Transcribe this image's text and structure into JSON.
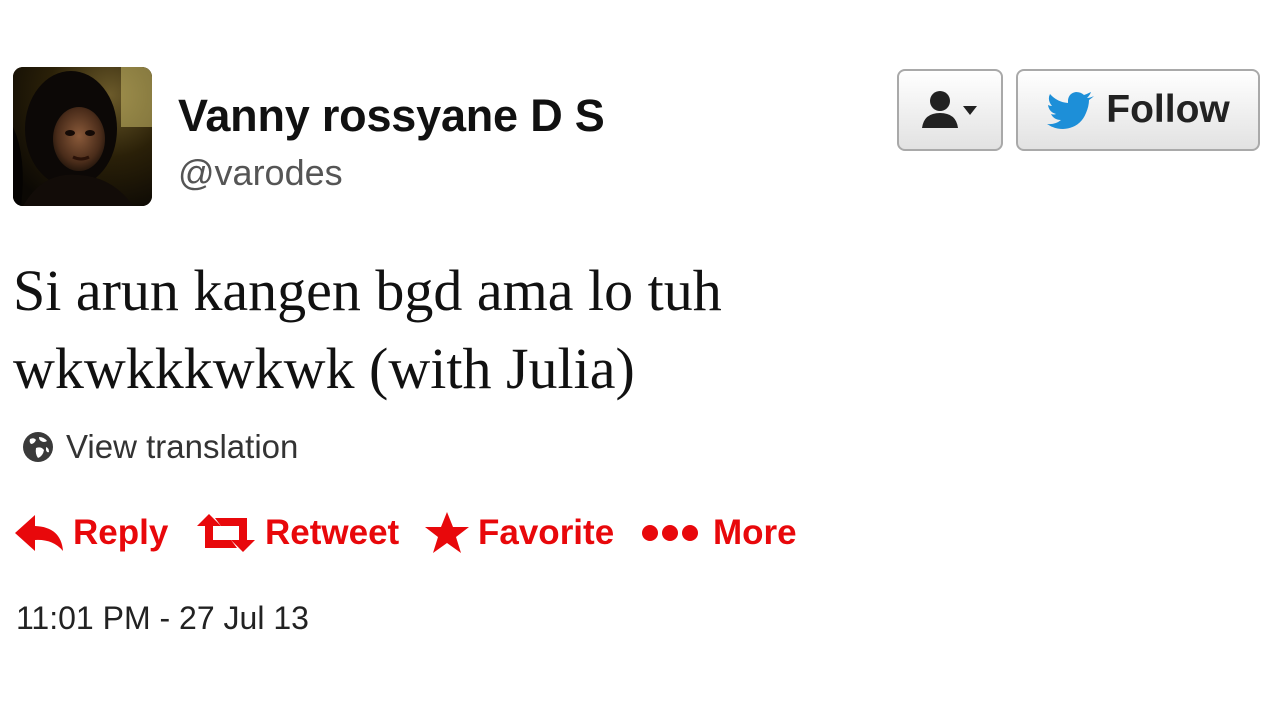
{
  "user": {
    "display_name": "Vanny rossyane D S",
    "screen_name": "@varodes"
  },
  "buttons": {
    "follow_label": "Follow",
    "user_dropdown_icon": "user-dropdown-icon"
  },
  "tweet": {
    "text_line1": "Si arun kangen bgd ama lo tuh",
    "text_line2": "wkwkkkwkwk (with Julia)",
    "translate_label": "View translation"
  },
  "actions": {
    "reply": "Reply",
    "retweet": "Retweet",
    "favorite": "Favorite",
    "more": "More"
  },
  "timestamp": "11:01 PM - 27 Jul 13",
  "colors": {
    "action_red": "#e8080b",
    "twitter_blue": "#1d8fd8",
    "screen_name_gray": "#555555"
  }
}
